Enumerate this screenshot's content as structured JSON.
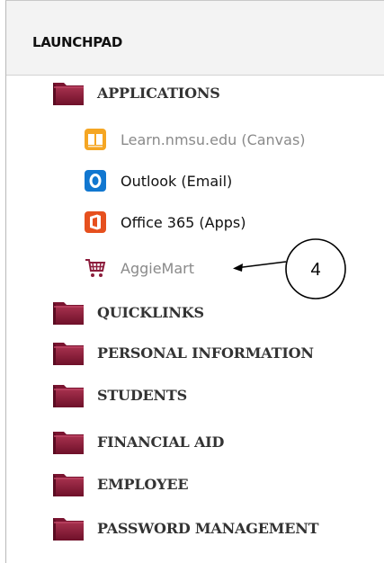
{
  "launchpad": {
    "title": "LAUNCHPAD"
  },
  "folders": {
    "applications": "APPLICATIONS",
    "quicklinks": "QUICKLINKS",
    "personal_information": "PERSONAL INFORMATION",
    "students": "STUDENTS",
    "financial_aid": "FINANCIAL AID",
    "employee": "EMPLOYEE",
    "password_management": "PASSWORD MANAGEMENT"
  },
  "applications": {
    "canvas": {
      "label": "Learn.nmsu.edu (Canvas)",
      "icon": "book-icon",
      "color": "#f5a623"
    },
    "outlook": {
      "label": "Outlook (Email)",
      "icon": "outlook-icon",
      "color": "#1177d0"
    },
    "office": {
      "label": "Office 365 (Apps)",
      "icon": "office-icon",
      "color": "#e6501e"
    },
    "aggiemart": {
      "label": "AggieMart",
      "icon": "shopping-cart-icon",
      "color": "#8c1d3c"
    }
  },
  "annotation": {
    "number": "4"
  },
  "colors": {
    "folder": "#8c1d3c",
    "header_bg": "#f3f3f3"
  }
}
